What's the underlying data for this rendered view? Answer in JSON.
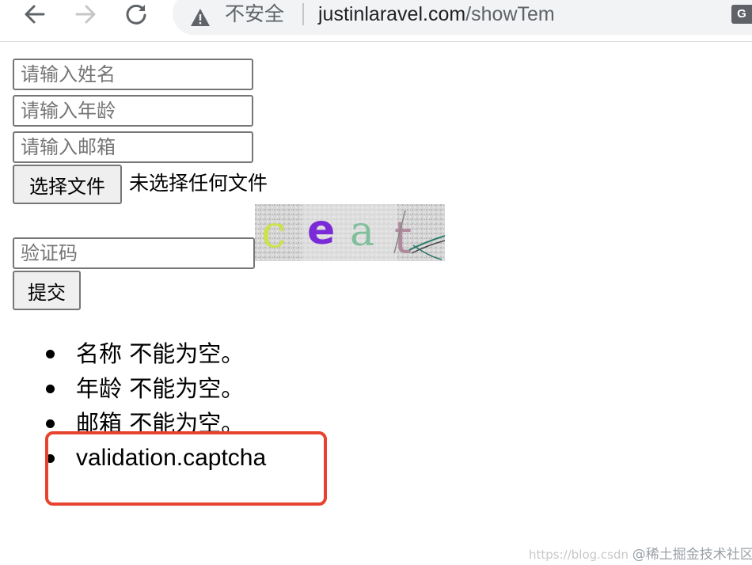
{
  "browser": {
    "back_icon": "arrow-left-icon",
    "forward_icon": "arrow-right-icon",
    "reload_icon": "reload-icon",
    "security_icon": "warning-triangle-icon",
    "security_label": "不安全",
    "url_host": "justinlaravel.com",
    "url_path": "/showTem",
    "translate_icon": "translate-icon",
    "translate_glyph": "G"
  },
  "form": {
    "name_placeholder": "请输入姓名",
    "age_placeholder": "请输入年龄",
    "email_placeholder": "请输入邮箱",
    "file_button_label": "选择文件",
    "file_status": "未选择任何文件",
    "captcha_text": "ceat",
    "captcha_placeholder": "验证码",
    "submit_label": "提交"
  },
  "errors": [
    "名称 不能为空。",
    "年龄 不能为空。",
    "邮箱 不能为空。",
    "validation.captcha"
  ],
  "watermark": {
    "url": "https://blog.csdn",
    "brand": "@稀土掘金技术社区"
  },
  "colors": {
    "highlight_border": "#e8432f",
    "toolbar_bg": "#ffffff",
    "urlbar_bg": "#f1f3f4"
  }
}
